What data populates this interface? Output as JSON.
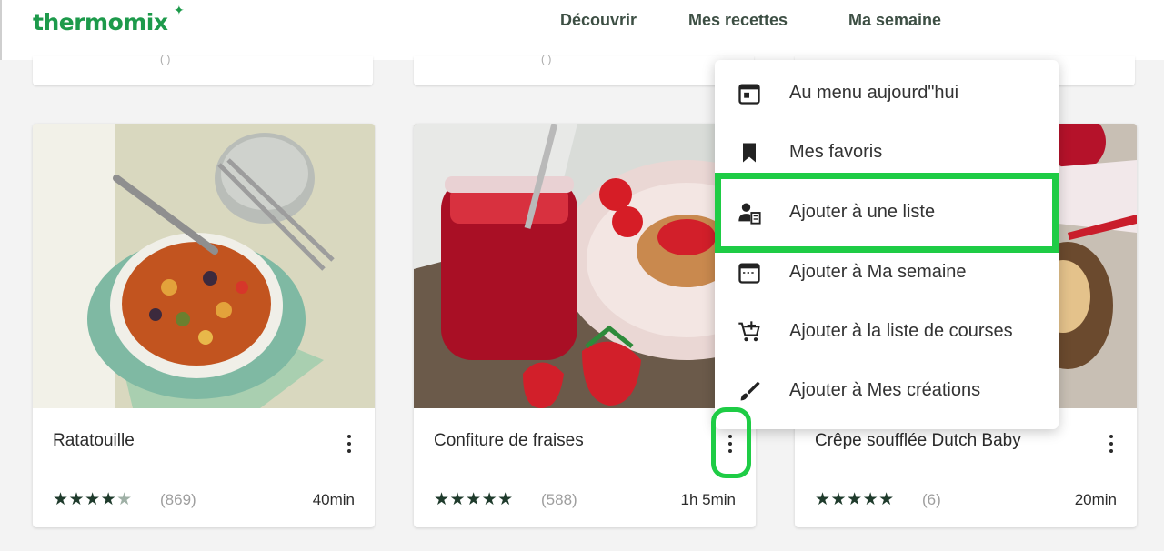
{
  "header": {
    "logo": "thermomix",
    "nav": [
      "Découvrir",
      "Mes recettes",
      "Ma semaine"
    ]
  },
  "cards": [
    {
      "title": "Ratatouille",
      "stars": "★★★★",
      "half_star": "★",
      "count": "(869)",
      "time": "40min"
    },
    {
      "title": "Confiture de fraises",
      "stars": "★★★★★",
      "half_star": "",
      "count": "(588)",
      "time": "1h 5min"
    },
    {
      "title": "Crêpe soufflée Dutch Baby",
      "stars": "★★★★★",
      "half_star": "",
      "count": "(6)",
      "time": "20min"
    }
  ],
  "menu": {
    "items": [
      {
        "label": "Au menu aujourd\"hui",
        "icon": "calendar-today-icon"
      },
      {
        "label": "Mes favoris",
        "icon": "bookmark-icon"
      },
      {
        "label": "Ajouter à une liste",
        "icon": "person-list-icon"
      },
      {
        "label": "Ajouter à Ma semaine",
        "icon": "calendar-icon"
      },
      {
        "label": "Ajouter à la liste de courses",
        "icon": "cart-add-icon"
      },
      {
        "label": "Ajouter à Mes créations",
        "icon": "brush-icon"
      }
    ]
  },
  "colors": {
    "brand": "#1d9a4b",
    "highlight": "#1ecc45",
    "stars": "#1f3b2c"
  }
}
